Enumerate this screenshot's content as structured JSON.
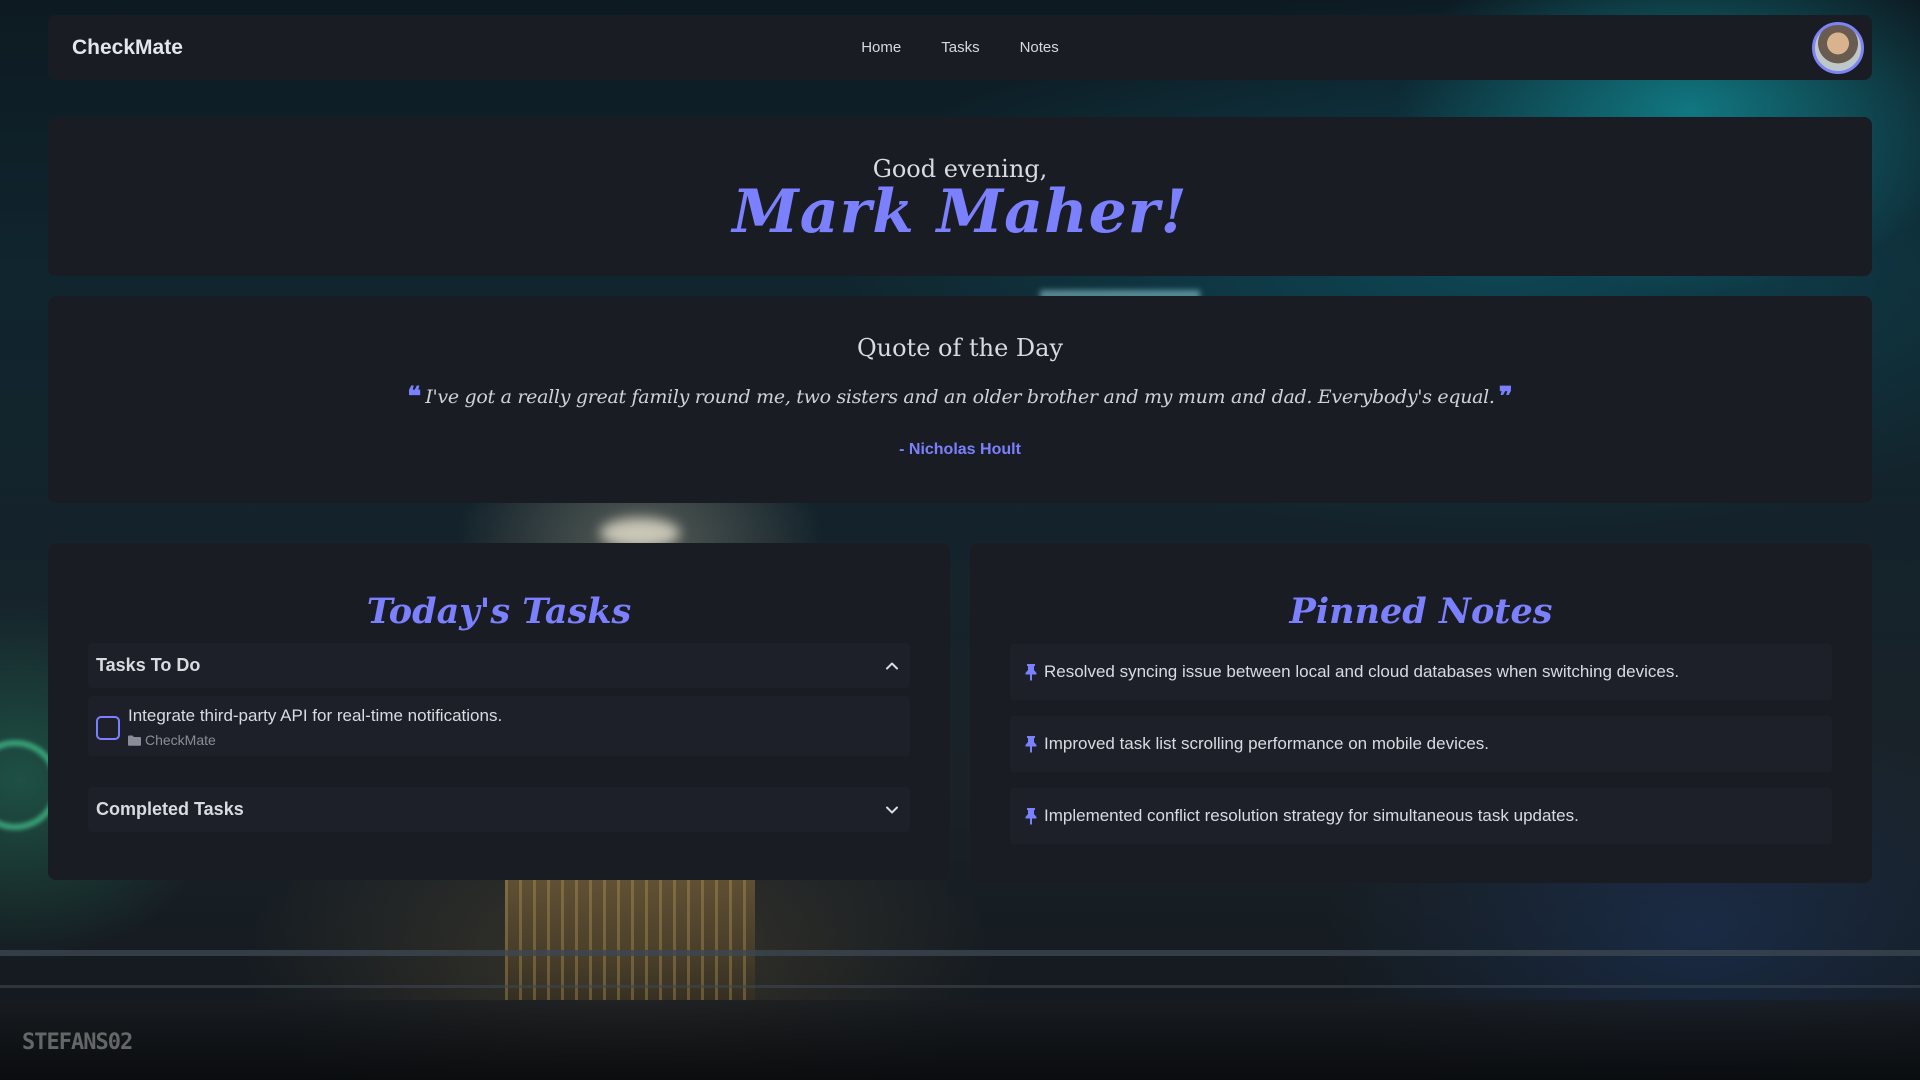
{
  "nav": {
    "brand": "CheckMate",
    "links": [
      "Home",
      "Tasks",
      "Notes"
    ]
  },
  "greeting": {
    "salutation": "Good evening,",
    "name": "Mark Maher!"
  },
  "quote": {
    "title": "Quote of the Day",
    "open_mark": "❝",
    "text": "I've got a really great family round me, two sisters and an older brother and my mum and dad. Everybody's equal.",
    "close_mark": "❞",
    "author": "- Nicholas Hoult"
  },
  "tasks": {
    "title": "Today's Tasks",
    "todo_label": "Tasks To Do",
    "todo_items": [
      {
        "text": "Integrate third-party API for real-time notifications.",
        "project": "CheckMate",
        "completed": false
      }
    ],
    "completed_label": "Completed Tasks"
  },
  "notes": {
    "title": "Pinned Notes",
    "items": [
      "Resolved syncing issue between local and cloud databases when switching devices.",
      "Improved task list scrolling performance on mobile devices.",
      "Implemented conflict resolution strategy for simultaneous task updates."
    ]
  },
  "watermark": "STEFANS02",
  "icons": {
    "pin": "pin-icon",
    "folder": "folder-icon",
    "chevron_up": "chevron-up-icon",
    "chevron_down": "chevron-down-icon"
  },
  "colors": {
    "accent": "#7b80ff",
    "panel": "#1a1c24",
    "item": "#1e2029"
  }
}
